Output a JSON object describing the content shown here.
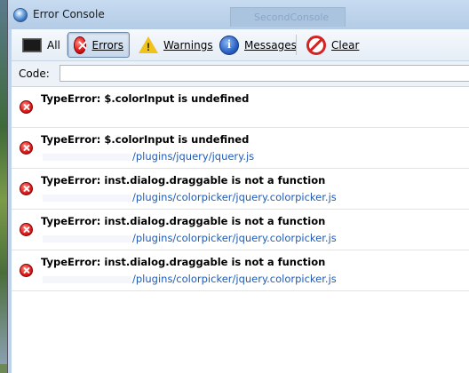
{
  "window": {
    "title": "Error Console",
    "background_tab": "SecondConsole"
  },
  "toolbar": {
    "all": "All",
    "errors": "Errors",
    "warnings": "Warnings",
    "messages": "Messages",
    "clear": "Clear",
    "active": "errors"
  },
  "code": {
    "label": "Code:",
    "value": ""
  },
  "messages": [
    {
      "text": "TypeError: $.colorInput is undefined",
      "source": ""
    },
    {
      "text": "TypeError: $.colorInput is undefined",
      "source": "/plugins/jquery/jquery.js"
    },
    {
      "text": "TypeError: inst.dialog.draggable is not a function",
      "source": "/plugins/colorpicker/jquery.colorpicker.js"
    },
    {
      "text": "TypeError: inst.dialog.draggable is not a function",
      "source": "/plugins/colorpicker/jquery.colorpicker.js"
    },
    {
      "text": "TypeError: inst.dialog.draggable is not a function",
      "source": "/plugins/colorpicker/jquery.colorpicker.js"
    }
  ],
  "colors": {
    "link": "#1d5bb8",
    "error": "#e02020"
  }
}
